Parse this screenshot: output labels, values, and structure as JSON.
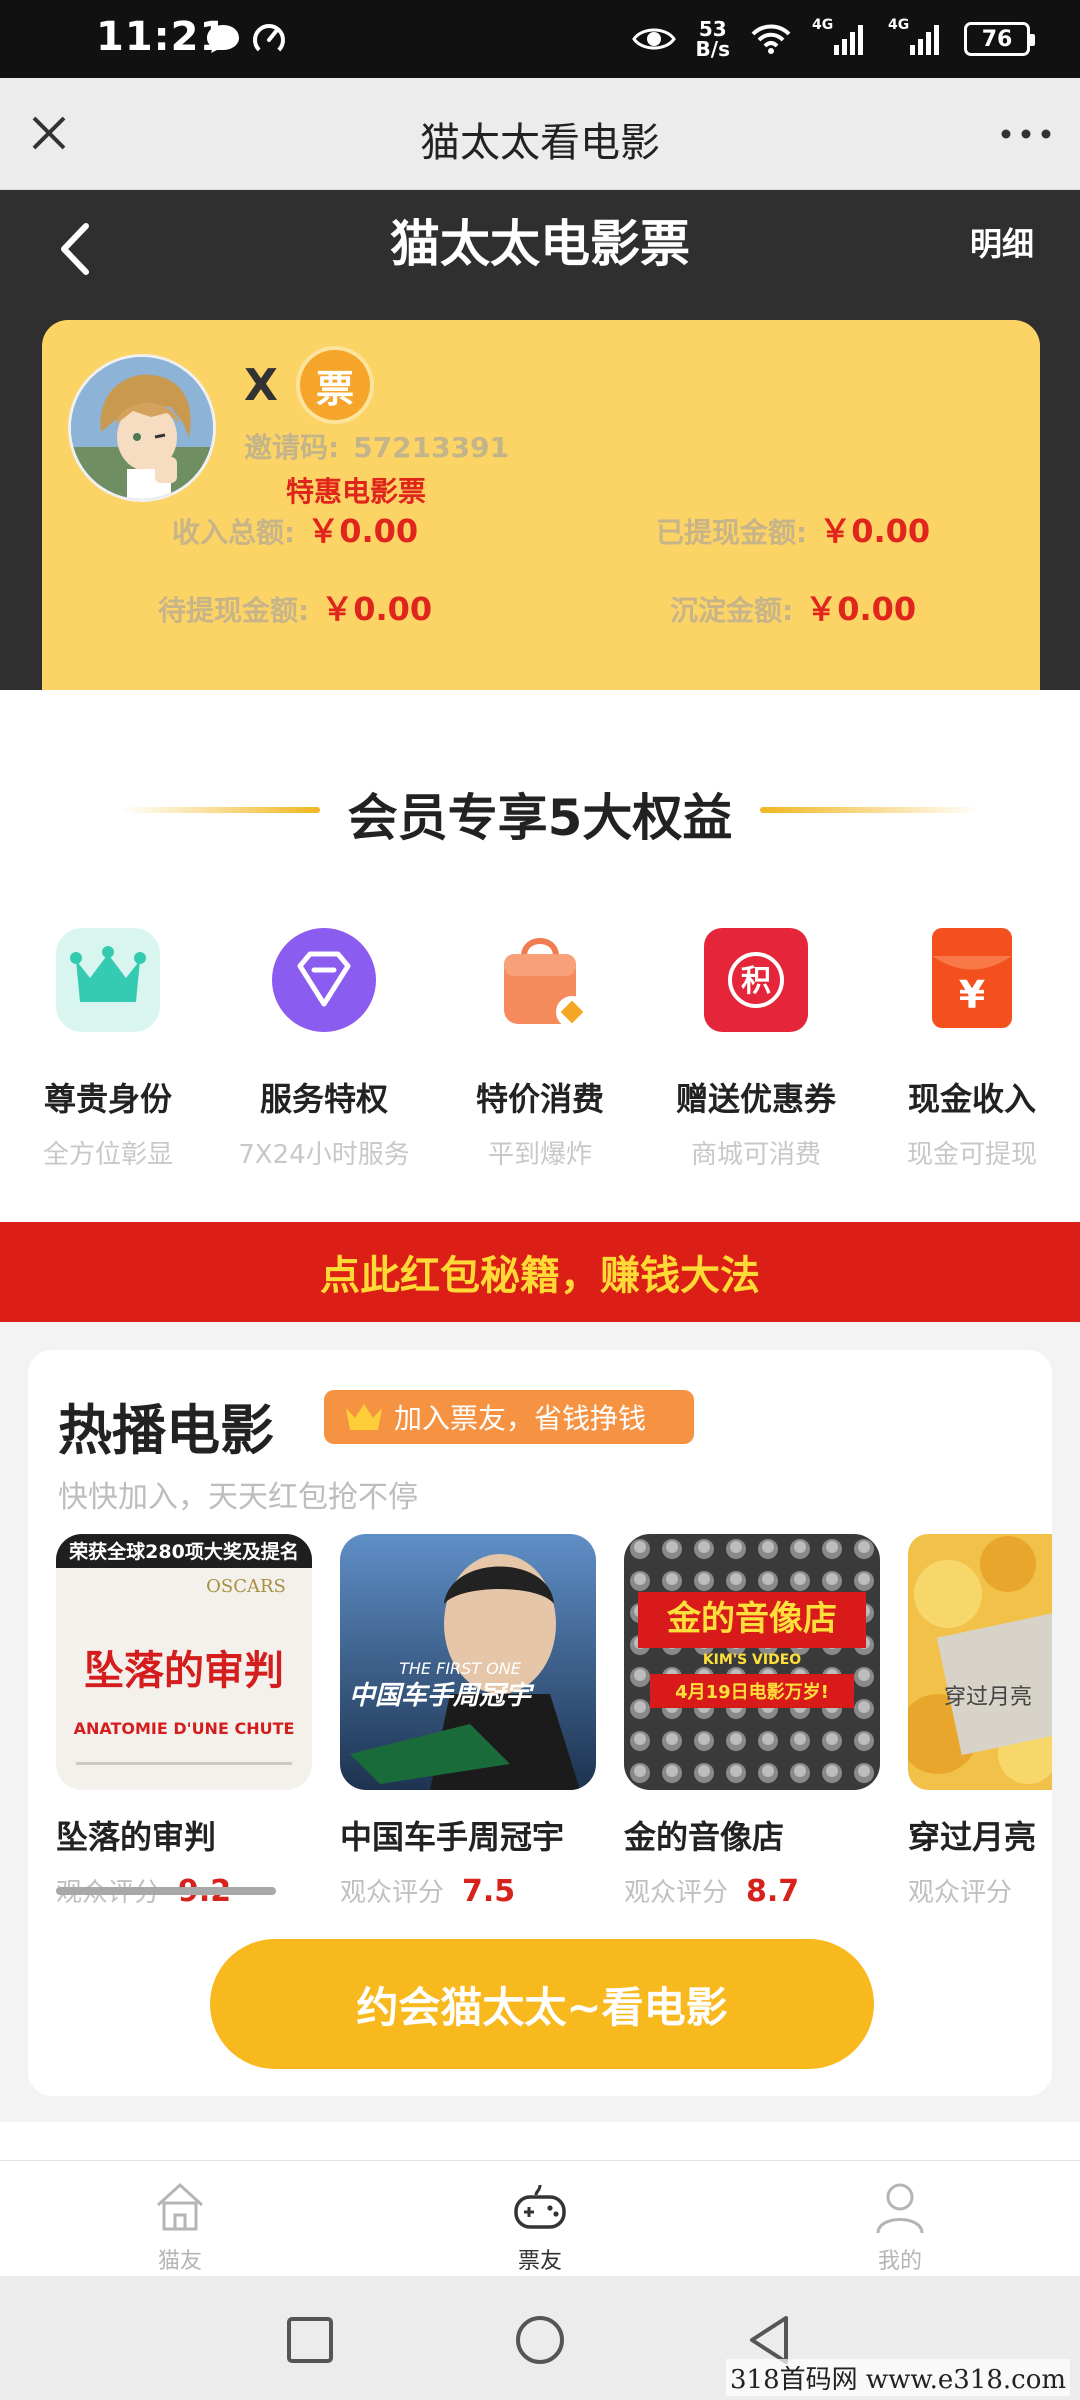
{
  "status_bar": {
    "time": "11:21",
    "speed_value": "53",
    "speed_unit": "B/s",
    "battery": "76",
    "net_label_1": "4G",
    "net_label_2": "4G"
  },
  "webview": {
    "title": "猫太太看电影"
  },
  "header": {
    "title": "猫太太电影票",
    "detail_link": "明细"
  },
  "user": {
    "name": "X",
    "badge": "票",
    "invite_label": "邀请码:",
    "invite_code": "57213391",
    "tagline": "特惠电影票",
    "stats": {
      "total_income_label": "收入总额:",
      "total_income": "￥0.00",
      "withdrawn_label": "已提现金额:",
      "withdrawn": "￥0.00",
      "pending_label": "待提现金额:",
      "pending": "￥0.00",
      "settled_label": "沉淀金额:",
      "settled": "￥0.00"
    }
  },
  "benefits": {
    "title": "会员专享5大权益",
    "items": [
      {
        "title": "尊贵身份",
        "sub": "全方位彰显",
        "icon": "crown-icon"
      },
      {
        "title": "服务特权",
        "sub": "7X24小时服务",
        "icon": "diamond-icon"
      },
      {
        "title": "特价消费",
        "sub": "平到爆炸",
        "icon": "shopping-bag-icon"
      },
      {
        "title": "赠送优惠券",
        "sub": "商城可消费",
        "icon": "points-coupon-icon",
        "glyph": "积"
      },
      {
        "title": "现金收入",
        "sub": "现金可提现",
        "icon": "red-envelope-icon",
        "glyph": "¥"
      }
    ]
  },
  "banner": {
    "text": "点此红包秘籍，赚钱大法"
  },
  "hot_movies": {
    "title": "热播电影",
    "join_label": "加入票友，省钱挣钱",
    "subtitle": "快快加入，天天红包抢不停",
    "rating_label": "观众评分",
    "movies": [
      {
        "name": "坠落的审判",
        "score": "9.2",
        "poster_text": "坠落的审判",
        "poster_top": "荣获全球280项大奖及提名",
        "poster_en": "ANATOMIE D'UNE CHUTE",
        "poster_brand": "OSCARS"
      },
      {
        "name": "中国车手周冠宇",
        "score": "7.5",
        "poster_text": "中国车手周冠宇",
        "poster_en": "THE FIRST ONE"
      },
      {
        "name": "金的音像店",
        "score": "8.7",
        "poster_text": "金的音像店",
        "poster_en": "KIM'S VIDEO",
        "poster_date": "4月19日电影万岁!"
      },
      {
        "name": "穿过月亮",
        "score": "",
        "poster_text": "穿过月亮"
      }
    ],
    "scroll_progress": 0.25,
    "cta": "约会猫太太~看电影"
  },
  "tabbar": {
    "tabs": [
      {
        "label": "猫友",
        "icon": "home-icon"
      },
      {
        "label": "票友",
        "icon": "gamepad-icon"
      },
      {
        "label": "我的",
        "icon": "profile-icon"
      }
    ]
  },
  "watermark": "318首码网 www.e318.com"
}
